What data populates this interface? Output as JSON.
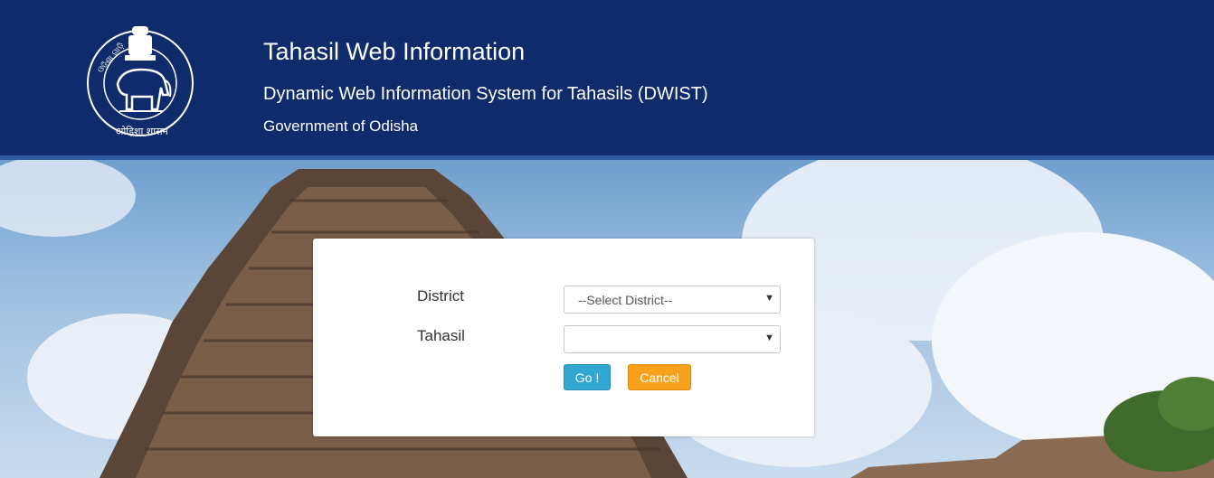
{
  "header": {
    "title": "Tahasil Web Information",
    "subtitle": "Dynamic Web Information System for Tahasils (DWIST)",
    "government": "Government of Odisha",
    "emblem_text_top": "ଓଡ଼ିଶା ଗାଡ଼ି",
    "emblem_text_bottom": "ओड़िशा शासन",
    "background_color": "#0f2b6b"
  },
  "form": {
    "district_label": "District",
    "district_value": "--Select District--",
    "tahasil_label": "Tahasil",
    "tahasil_value": "",
    "go_label": "Go !",
    "cancel_label": "Cancel"
  },
  "colors": {
    "go_button": "#31a6d0",
    "cancel_button": "#f7a11d"
  }
}
